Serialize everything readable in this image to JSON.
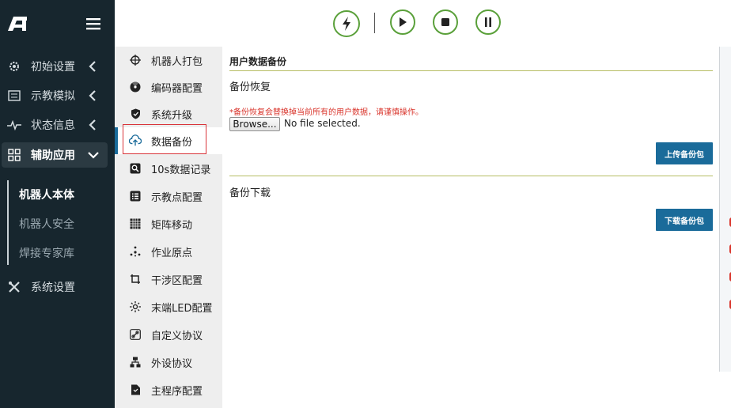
{
  "sidebar": {
    "items": [
      {
        "label": "初始设置",
        "icon": "gear-icon"
      },
      {
        "label": "示教模拟",
        "icon": "list-icon"
      },
      {
        "label": "状态信息",
        "icon": "pulse-icon"
      },
      {
        "label": "辅助应用",
        "icon": "grid-icon"
      }
    ],
    "subitems": [
      {
        "label": "机器人本体"
      },
      {
        "label": "机器人安全"
      },
      {
        "label": "焊接专家库"
      }
    ],
    "system": {
      "label": "系统设置",
      "icon": "tools-icon"
    }
  },
  "toolbar": {
    "buttons": [
      "lightning-icon",
      "play-icon",
      "stop-icon",
      "pause-icon"
    ],
    "accent": "#5aa03a"
  },
  "submenu": {
    "items": [
      {
        "label": "机器人打包",
        "icon": "crosshair-icon"
      },
      {
        "label": "编码器配置",
        "icon": "radiation-icon"
      },
      {
        "label": "系统升级",
        "icon": "shield-icon"
      },
      {
        "label": "数据备份",
        "icon": "cloud-upload-icon"
      },
      {
        "label": "10s数据记录",
        "icon": "search-icon"
      },
      {
        "label": "示教点配置",
        "icon": "list-box-icon"
      },
      {
        "label": "矩阵移动",
        "icon": "matrix-icon"
      },
      {
        "label": "作业原点",
        "icon": "origin-icon"
      },
      {
        "label": "干涉区配置",
        "icon": "crop-icon"
      },
      {
        "label": "末端LED配置",
        "icon": "sun-icon"
      },
      {
        "label": "自定义协议",
        "icon": "link-icon"
      },
      {
        "label": "外设协议",
        "icon": "network-icon"
      },
      {
        "label": "主程序配置",
        "icon": "file-icon"
      }
    ]
  },
  "main": {
    "title": "用户数据备份",
    "restore_title": "备份恢复",
    "warning": "*备份恢复会替换掉当前所有的用户数据，请谨慎操作。",
    "browse_label": "Browse...",
    "no_file_text": "No file selected.",
    "upload_label": "上传备份包",
    "download_title": "备份下载",
    "download_label": "下载备份包"
  },
  "colors": {
    "sidebar_bg": "#17262e",
    "primary_button": "#1a6b9a",
    "warning": "#d9342b",
    "divider": "#b6bd63"
  }
}
